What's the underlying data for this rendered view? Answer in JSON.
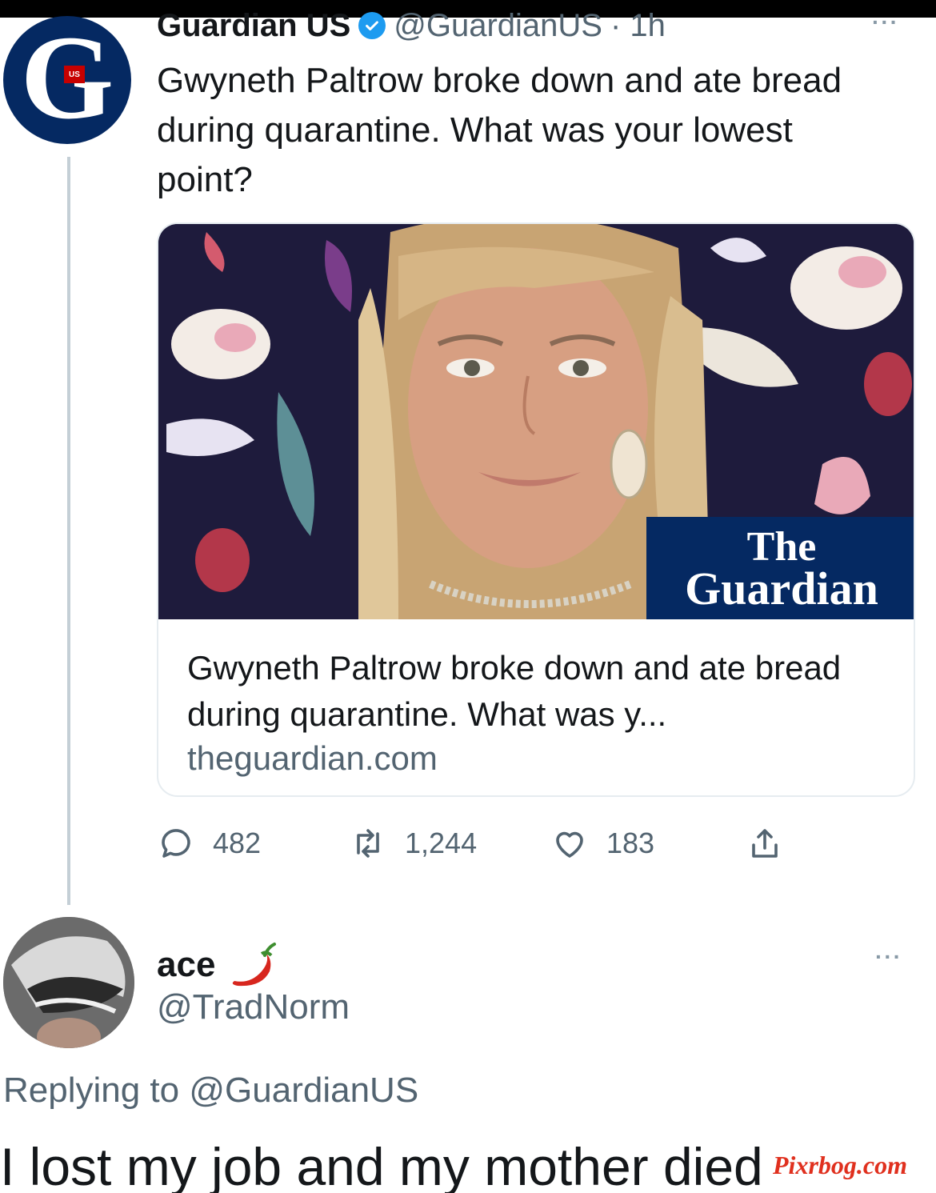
{
  "tweet": {
    "author_name": "Guardian US",
    "author_handle": "@GuardianUS",
    "timestamp": "· 1h",
    "avatar_letter": "G",
    "avatar_badge": "US",
    "text": "Gwyneth Paltrow broke down and ate bread during quarantine. What was your lowest point?",
    "card": {
      "brand_line1": "The",
      "brand_line2": "Guardian",
      "title": "Gwyneth Paltrow broke down and ate bread during quarantine. What was y...",
      "domain": "theguardian.com"
    },
    "actions": {
      "replies": "482",
      "retweets": "1,244",
      "likes": "183"
    },
    "more_label": "···"
  },
  "reply": {
    "author_name": "ace",
    "author_emoji_icon": "chili-pepper-icon",
    "author_handle": "@TradNorm",
    "replying_prefix": "Replying to",
    "replying_to": "@GuardianUS",
    "text": "I lost my job and my mother died",
    "more_label": "···"
  },
  "watermark": "Pixrbog.com",
  "colors": {
    "guardian_navy": "#052962",
    "verified_blue": "#1d9bf0",
    "muted_text": "#536471",
    "watermark_red": "#e0301e"
  }
}
